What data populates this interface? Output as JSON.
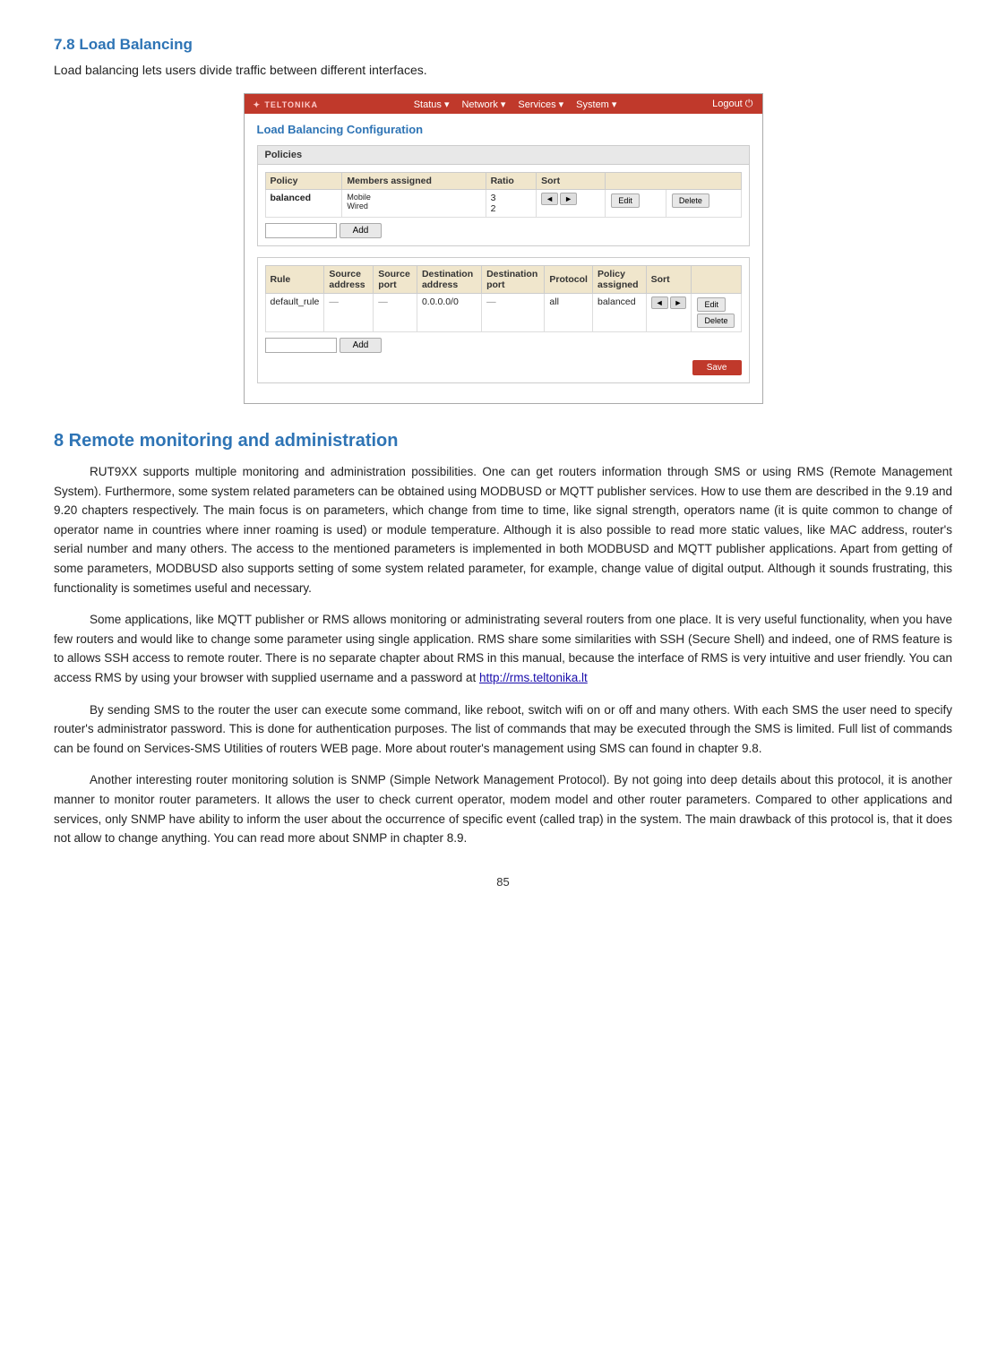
{
  "section78": {
    "heading": "7.8   Load Balancing",
    "intro": "Load balancing lets users divide traffic between different interfaces."
  },
  "router": {
    "logo": "TELTONIKA",
    "nav": {
      "items": [
        "Status ▾",
        "Network ▾",
        "Services ▾",
        "System ▾"
      ],
      "logout": "Logout ⏻"
    },
    "page_title": "Load Balancing Configuration",
    "policies_section": "Policies",
    "policies_table": {
      "headers": [
        "Policy",
        "Members assigned",
        "Ratio",
        "Sort",
        "",
        ""
      ],
      "rows": [
        {
          "policy": "balanced",
          "members": [
            "Mobile",
            "Wired"
          ],
          "ratio": [
            "3",
            "2"
          ],
          "sort": "◄ ►",
          "btn1": "Edit",
          "btn2": "Delete"
        }
      ]
    },
    "add_policy_btn": "Add",
    "rules_table": {
      "headers": [
        "Rule",
        "Source address",
        "Source port",
        "Destination address",
        "Destination port",
        "Protocol",
        "Policy assigned",
        "Sort",
        ""
      ],
      "rows": [
        {
          "rule": "default_rule",
          "source_addr": "—",
          "source_port": "—",
          "dest_addr": "0.0.0.0/0",
          "dest_port": "—",
          "protocol": "all",
          "policy": "balanced",
          "sort": "◄ ►",
          "btn1": "Edit",
          "btn2": "Delete"
        }
      ]
    },
    "add_rule_btn": "Add",
    "save_btn": "Save"
  },
  "section8": {
    "heading": "8   Remote monitoring and administration",
    "para1": "RUT9XX supports multiple monitoring and administration possibilities. One can get routers information through SMS or using RMS (Remote Management System). Furthermore, some system related parameters can be obtained using MODBUSD or MQTT publisher services. How to use them are described in the 9.19 and 9.20 chapters respectively. The main focus is on parameters, which change from time to time, like signal strength, operators name (it is quite common to change of operator name in countries where inner roaming is used) or module temperature. Although it is also possible to read more static values, like MAC address, router's serial number and many others. The access to the mentioned parameters is implemented in both MODBUSD and MQTT publisher applications.  Apart from getting of some parameters, MODBUSD also supports setting of some system related parameter, for example, change value of digital output. Although it sounds frustrating, this functionality is sometimes useful and necessary.",
    "para2": "Some applications, like MQTT publisher or RMS allows monitoring or administrating several routers from one place. It is very useful functionality, when you have few routers and would like to change some parameter using single application. RMS share some similarities with SSH (Secure Shell) and indeed, one of RMS feature is to allows SSH access to remote router.  There is no separate chapter about RMS in this manual, because the interface of RMS is very intuitive and user friendly. You can access RMS by using your browser with supplied username and a password at ",
    "rms_link": "http://rms.teltonika.lt",
    "para3": "By sending SMS to the router the user can execute some command, like reboot, switch wifi on or off and many others. With each SMS the user need to specify router's administrator password. This is done for authentication purposes. The list of commands that may be executed through the SMS is limited. Full list of commands can be found on Services-SMS Utilities of routers WEB page.  More about router's management using SMS can found in chapter 9.8.",
    "para4": "Another interesting router monitoring solution is SNMP (Simple Network Management Protocol). By not going into deep details about this protocol, it is another manner to monitor router parameters. It allows the user to check current operator, modem model and other router parameters. Compared to other applications and services, only SNMP have ability to inform the user about the occurrence of specific event (called trap) in the system. The main drawback of this protocol is, that it does not allow to change anything. You can read more about SNMP in chapter 8.9."
  },
  "page_number": "85"
}
